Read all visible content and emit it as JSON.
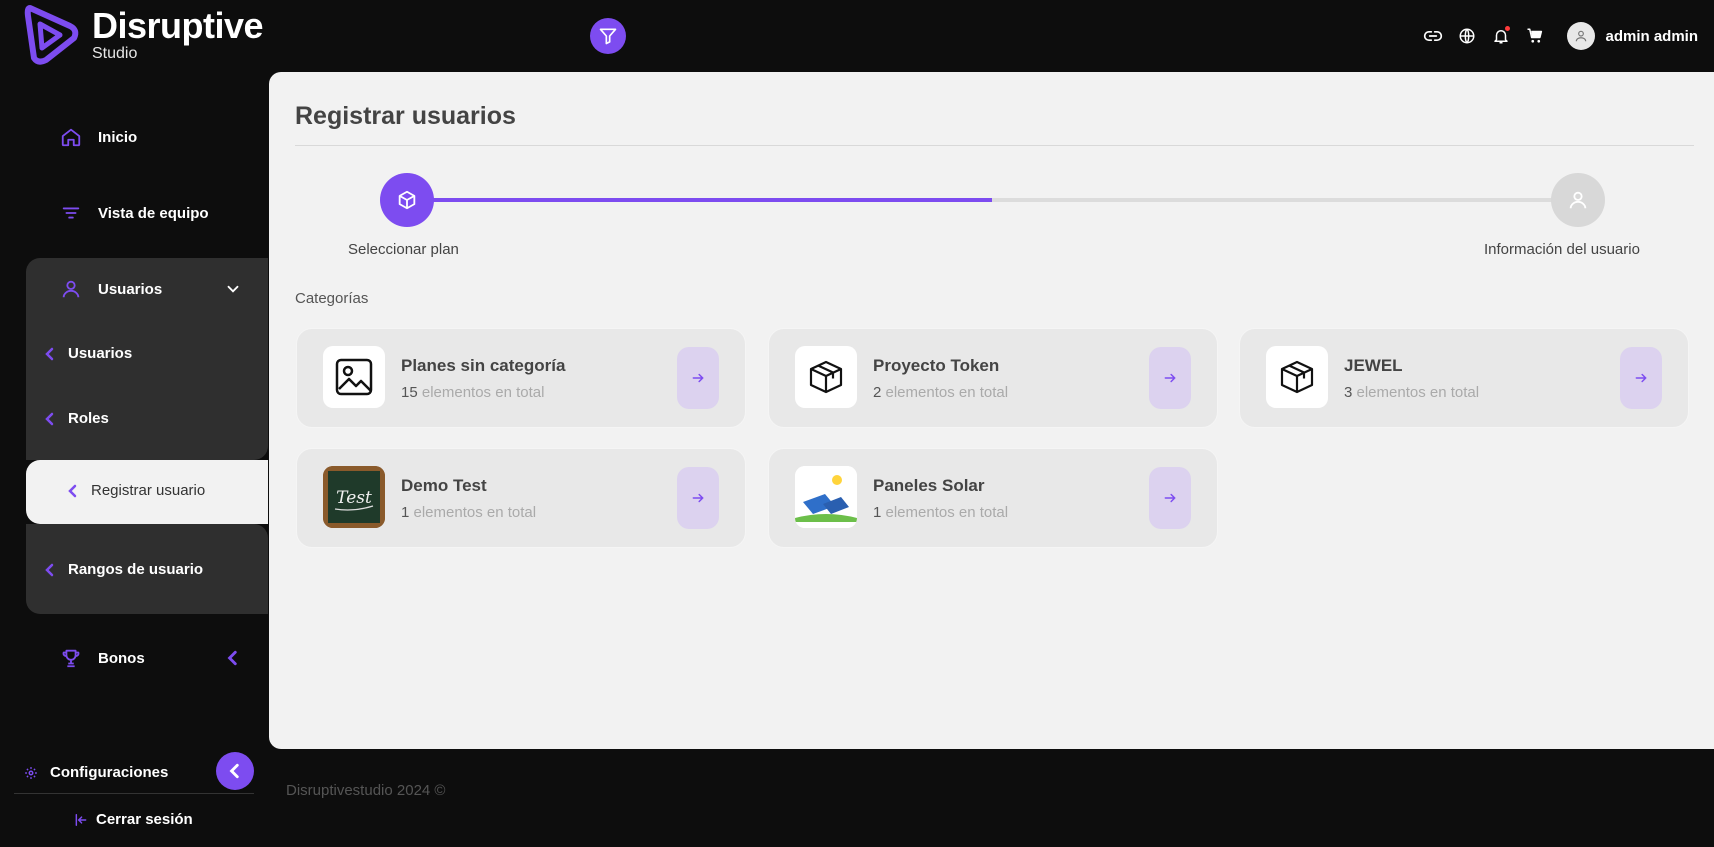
{
  "brand": {
    "title": "Disruptive",
    "subtitle": "Studio"
  },
  "header": {
    "user_name": "admin admin",
    "icons": [
      "filter-icon",
      "link-icon",
      "globe-icon",
      "bell-icon",
      "cart-icon",
      "user-avatar-icon"
    ]
  },
  "sidebar": {
    "items": [
      {
        "label": "Inicio",
        "icon": "home-icon"
      },
      {
        "label": "Vista de equipo",
        "icon": "filter-lines-icon"
      },
      {
        "label": "Usuarios",
        "icon": "user-icon"
      },
      {
        "label": "Bonos",
        "icon": "trophy-icon"
      }
    ],
    "submenu": [
      "Usuarios",
      "Roles",
      "Registrar usuario",
      "Rangos de usuario"
    ],
    "settings_label": "Configuraciones",
    "logout_label": "Cerrar sesión"
  },
  "main": {
    "title": "Registrar usuarios",
    "steps": [
      {
        "label": "Seleccionar plan",
        "icon": "cube-icon"
      },
      {
        "label": "Información del usuario",
        "icon": "user-icon"
      }
    ],
    "progress_fraction": 0.5,
    "categories_label": "Categorías",
    "cards": [
      {
        "title": "Planes sin categoría",
        "count": "15",
        "suffix": " elementos en total",
        "thumb": "image-icon"
      },
      {
        "title": "Proyecto Token",
        "count": "2",
        "suffix": " elementos en total",
        "thumb": "box-icon"
      },
      {
        "title": "JEWEL",
        "count": "3",
        "suffix": " elementos en total",
        "thumb": "box-icon"
      },
      {
        "title": "Demo Test",
        "count": "1",
        "suffix": " elementos en total",
        "thumb": "chalkboard-test-image",
        "thumb_text": "Test"
      },
      {
        "title": "Paneles Solar",
        "count": "1",
        "suffix": " elementos en total",
        "thumb": "solar-panel-image"
      }
    ]
  },
  "footer": {
    "text": "Disruptivestudio 2024 ©"
  },
  "colors": {
    "accent": "#7d4cf0",
    "background": "#0d0d0d",
    "content": "#f2f2f2",
    "card": "#e8e8e8",
    "arrow_bg": "#dcd2ef"
  }
}
